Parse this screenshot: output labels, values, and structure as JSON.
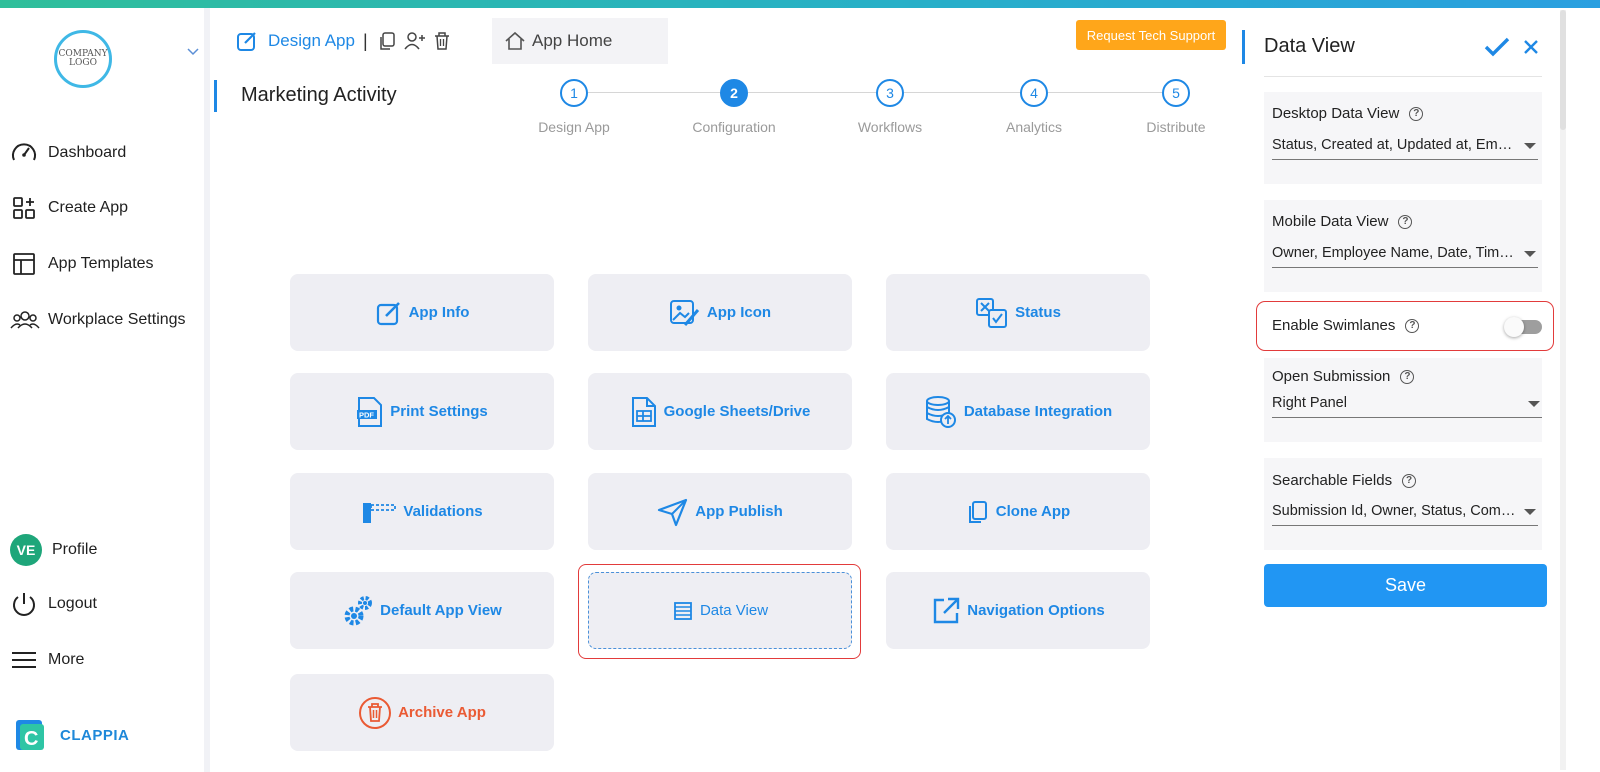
{
  "colors": {
    "accent": "#1e88e5",
    "support": "#ffa61a",
    "danger": "#ea5a34",
    "highlight": "#e23b3b"
  },
  "sidebar": {
    "logo_text": "COMPANY LOGO",
    "items": [
      {
        "label": "Dashboard",
        "icon": "speedometer-icon"
      },
      {
        "label": "Create App",
        "icon": "grid-plus-icon"
      },
      {
        "label": "App Templates",
        "icon": "template-icon"
      },
      {
        "label": "Workplace Settings",
        "icon": "users-icon"
      }
    ],
    "profile": {
      "initials": "VE",
      "label": "Profile"
    },
    "logout_label": "Logout",
    "more_label": "More",
    "brand": "CLAPPIA"
  },
  "header": {
    "tab_design": "Design App",
    "tab_separator": "|",
    "tab_home": "App Home",
    "support_button": "Request Tech Support",
    "app_title": "Marketing Activity"
  },
  "steps": [
    {
      "num": "1",
      "label": "Design App"
    },
    {
      "num": "2",
      "label": "Configuration"
    },
    {
      "num": "3",
      "label": "Workflows"
    },
    {
      "num": "4",
      "label": "Analytics"
    },
    {
      "num": "5",
      "label": "Distribute"
    }
  ],
  "cards": [
    {
      "label": "App Info",
      "icon": "edit-icon"
    },
    {
      "label": "App Icon",
      "icon": "image-edit-icon"
    },
    {
      "label": "Status",
      "icon": "status-icon"
    },
    {
      "label": "Print Settings",
      "icon": "pdf-icon"
    },
    {
      "label": "Google Sheets/Drive",
      "icon": "sheet-icon"
    },
    {
      "label": "Database Integration",
      "icon": "database-icon"
    },
    {
      "label": "Validations",
      "icon": "validation-icon"
    },
    {
      "label": "App Publish",
      "icon": "send-icon"
    },
    {
      "label": "Clone App",
      "icon": "copy-icon"
    },
    {
      "label": "Default App View",
      "icon": "gears-icon"
    },
    {
      "label": "Data View",
      "icon": "list-icon"
    },
    {
      "label": "Navigation Options",
      "icon": "external-link-icon"
    },
    {
      "label": "Archive App",
      "icon": "trash-circle-icon"
    }
  ],
  "panel": {
    "title": "Data View",
    "desktop": {
      "label": "Desktop Data View",
      "value": "Status, Created at, Updated at, Employee Name"
    },
    "mobile": {
      "label": "Mobile Data View",
      "value": "Owner, Employee Name, Date, Time, Status"
    },
    "swimlanes": {
      "label": "Enable Swimlanes",
      "enabled": false
    },
    "open_submission": {
      "label": "Open Submission",
      "value": "Right Panel"
    },
    "searchable": {
      "label": "Searchable Fields",
      "value": "Submission Id, Owner, Status, Comments"
    },
    "save_label": "Save",
    "help_glyph": "?"
  }
}
